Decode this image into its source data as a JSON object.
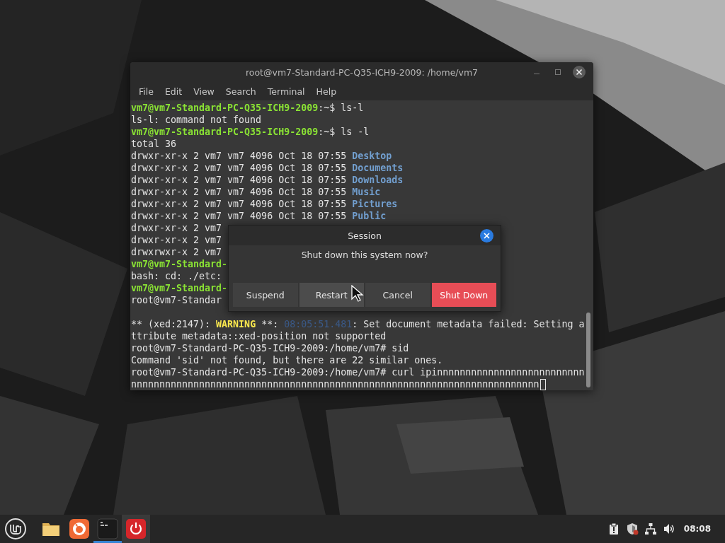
{
  "terminal": {
    "title": "root@vm7-Standard-PC-Q35-ICH9-2009: /home/vm7",
    "menu": [
      "File",
      "Edit",
      "View",
      "Search",
      "Terminal",
      "Help"
    ],
    "lines": [
      {
        "kind": "text",
        "segments": [
          {
            "kind": "prompt",
            "text": "vm7@vm7-Standard-PC-Q35-ICH9-2009"
          },
          {
            "kind": "text",
            "text": ":~$ ls-l"
          }
        ]
      },
      {
        "kind": "text",
        "segments": [
          {
            "kind": "text",
            "text": "ls-l: command not found"
          }
        ]
      },
      {
        "kind": "text",
        "segments": [
          {
            "kind": "prompt",
            "text": "vm7@vm7-Standard-PC-Q35-ICH9-2009"
          },
          {
            "kind": "text",
            "text": ":~$ ls -l"
          }
        ]
      },
      {
        "kind": "text",
        "segments": [
          {
            "kind": "text",
            "text": "total 36"
          }
        ]
      },
      {
        "kind": "text",
        "segments": [
          {
            "kind": "text",
            "text": "drwxr-xr-x 2 vm7 vm7 4096 Oct 18 07:55 "
          },
          {
            "kind": "dir",
            "text": "Desktop"
          }
        ]
      },
      {
        "kind": "text",
        "segments": [
          {
            "kind": "text",
            "text": "drwxr-xr-x 2 vm7 vm7 4096 Oct 18 07:55 "
          },
          {
            "kind": "dir",
            "text": "Documents"
          }
        ]
      },
      {
        "kind": "text",
        "segments": [
          {
            "kind": "text",
            "text": "drwxr-xr-x 2 vm7 vm7 4096 Oct 18 07:55 "
          },
          {
            "kind": "dir",
            "text": "Downloads"
          }
        ]
      },
      {
        "kind": "text",
        "segments": [
          {
            "kind": "text",
            "text": "drwxr-xr-x 2 vm7 vm7 4096 Oct 18 07:55 "
          },
          {
            "kind": "dir",
            "text": "Music"
          }
        ]
      },
      {
        "kind": "text",
        "segments": [
          {
            "kind": "text",
            "text": "drwxr-xr-x 2 vm7 vm7 4096 Oct 18 07:55 "
          },
          {
            "kind": "dir",
            "text": "Pictures"
          }
        ]
      },
      {
        "kind": "text",
        "segments": [
          {
            "kind": "text",
            "text": "drwxr-xr-x 2 vm7 vm7 4096 Oct 18 07:55 "
          },
          {
            "kind": "dir",
            "text": "Public"
          }
        ]
      },
      {
        "kind": "text",
        "segments": [
          {
            "kind": "text",
            "text": "drwxr-xr-x 2 vm7"
          }
        ]
      },
      {
        "kind": "text",
        "segments": [
          {
            "kind": "text",
            "text": "drwxr-xr-x 2 vm7"
          }
        ]
      },
      {
        "kind": "text",
        "segments": [
          {
            "kind": "text",
            "text": "drwxrwxr-x 2 vm7"
          }
        ]
      },
      {
        "kind": "text",
        "segments": [
          {
            "kind": "prompt",
            "text": "vm7@vm7-Standard-"
          }
        ]
      },
      {
        "kind": "text",
        "segments": [
          {
            "kind": "text",
            "text": "bash: cd: ./etc:"
          }
        ]
      },
      {
        "kind": "text",
        "segments": [
          {
            "kind": "prompt",
            "text": "vm7@vm7-Standard-"
          }
        ]
      },
      {
        "kind": "text",
        "segments": [
          {
            "kind": "text",
            "text": "root@vm7-Standar"
          }
        ]
      },
      {
        "kind": "blank"
      },
      {
        "kind": "text",
        "segments": [
          {
            "kind": "text",
            "text": "** (xed:2147): "
          },
          {
            "kind": "warning",
            "text": "WARNING"
          },
          {
            "kind": "text",
            "text": " **: "
          },
          {
            "kind": "timestamp",
            "text": "08:05:51.481"
          },
          {
            "kind": "text",
            "text": ": Set document metadata failed: Setting a"
          }
        ]
      },
      {
        "kind": "text",
        "segments": [
          {
            "kind": "text",
            "text": "ttribute metadata::xed-position not supported"
          }
        ]
      },
      {
        "kind": "text",
        "segments": [
          {
            "kind": "text",
            "text": "root@vm7-Standard-PC-Q35-ICH9-2009:/home/vm7# sid"
          }
        ]
      },
      {
        "kind": "text",
        "segments": [
          {
            "kind": "text",
            "text": "Command 'sid' not found, but there are 22 similar ones."
          }
        ]
      },
      {
        "kind": "text",
        "segments": [
          {
            "kind": "text",
            "text": "root@vm7-Standard-PC-Q35-ICH9-2009:/home/vm7# curl ipinnnnnnnnnnnnnnnnnnnnnnnnnn"
          }
        ]
      },
      {
        "kind": "text",
        "cursor": true,
        "segments": [
          {
            "kind": "text",
            "text": "nnnnnnnnnnnnnnnnnnnnnnnnnnnnnnnnnnnnnnnnnnnnnnnnnnnnnnnnnnnnnnnnnnnnnnnn"
          }
        ]
      }
    ]
  },
  "dialog": {
    "title": "Session",
    "message": "Shut down this system now?",
    "buttons": [
      {
        "label": "Suspend",
        "kind": "normal",
        "hovered": false
      },
      {
        "label": "Restart",
        "kind": "normal",
        "hovered": true
      },
      {
        "label": "Cancel",
        "kind": "normal",
        "hovered": false
      },
      {
        "label": "Shut Down",
        "kind": "destructive",
        "hovered": false
      }
    ]
  },
  "taskbar": {
    "apps": [
      {
        "kind": "files",
        "running": false,
        "active": false
      },
      {
        "kind": "browser",
        "running": false,
        "active": false
      },
      {
        "kind": "terminal",
        "running": true,
        "active": false
      },
      {
        "kind": "power",
        "running": false,
        "active": true
      }
    ],
    "clock": "08:08"
  }
}
